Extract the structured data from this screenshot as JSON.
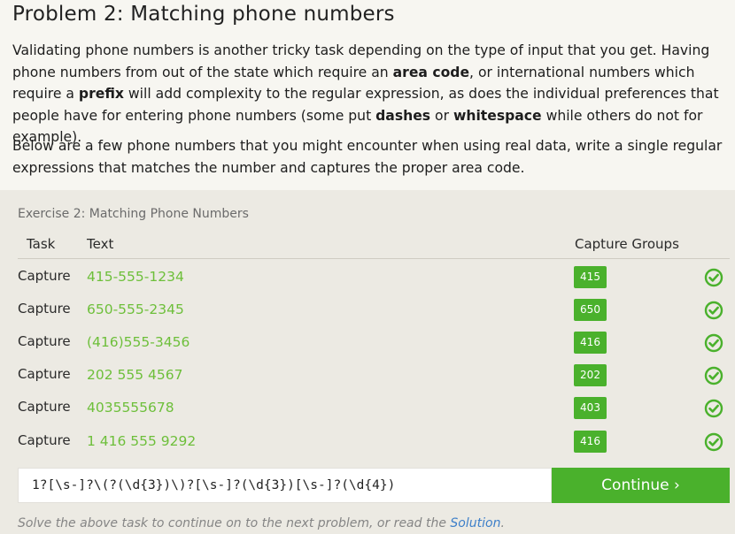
{
  "title": "Problem 2: Matching phone numbers",
  "intro": {
    "p1": [
      {
        "t": "Validating phone numbers is another tricky task depending on the type of input that you get. Having phone numbers from out of the state which require an ",
        "b": false
      },
      {
        "t": "area code",
        "b": true
      },
      {
        "t": ", or international numbers which require a ",
        "b": false
      },
      {
        "t": "prefix",
        "b": true
      },
      {
        "t": " will add complexity to the regular expression, as does the individual preferences that people have for entering phone numbers (some put ",
        "b": false
      },
      {
        "t": "dashes",
        "b": true
      },
      {
        "t": " or ",
        "b": false
      },
      {
        "t": "whitespace",
        "b": true
      },
      {
        "t": " while others do not for example).",
        "b": false
      }
    ],
    "p2": "Below are a few phone numbers that you might encounter when using real data, write a single regular expressions that matches the number and captures the proper area code."
  },
  "exercise": {
    "title": "Exercise 2: Matching Phone Numbers",
    "headers": {
      "task": "Task",
      "text": "Text",
      "capture": "Capture Groups"
    },
    "rows": [
      {
        "task": "Capture",
        "text": "415-555-1234",
        "group": "415",
        "status": "check-circle-icon"
      },
      {
        "task": "Capture",
        "text": "650-555-2345",
        "group": "650",
        "status": "check-circle-icon"
      },
      {
        "task": "Capture",
        "text": "(416)555-3456",
        "group": "416",
        "status": "check-circle-icon"
      },
      {
        "task": "Capture",
        "text": "202 555 4567",
        "group": "202",
        "status": "check-circle-icon"
      },
      {
        "task": "Capture",
        "text": "4035555678",
        "group": "403",
        "status": "check-circle-icon"
      },
      {
        "task": "Capture",
        "text": "1 416 555 9292",
        "group": "416",
        "status": "check-circle-icon"
      }
    ],
    "answer": "1?[\\s-]?\\(?(\\d{3})\\)?[\\s-]?(\\d{3})[\\s-]?(\\d{4})",
    "continue_label": "Continue ›",
    "footer_prefix": "Solve the above task to continue on to the next problem, or read the ",
    "footer_link": "Solution",
    "footer_suffix": "."
  },
  "colors": {
    "accent_green": "#4ab12c",
    "match_text_green": "#6dbf3a",
    "link_blue": "#3d7fc9",
    "panel_bg": "#eceae3",
    "page_bg": "#f7f6f1"
  }
}
